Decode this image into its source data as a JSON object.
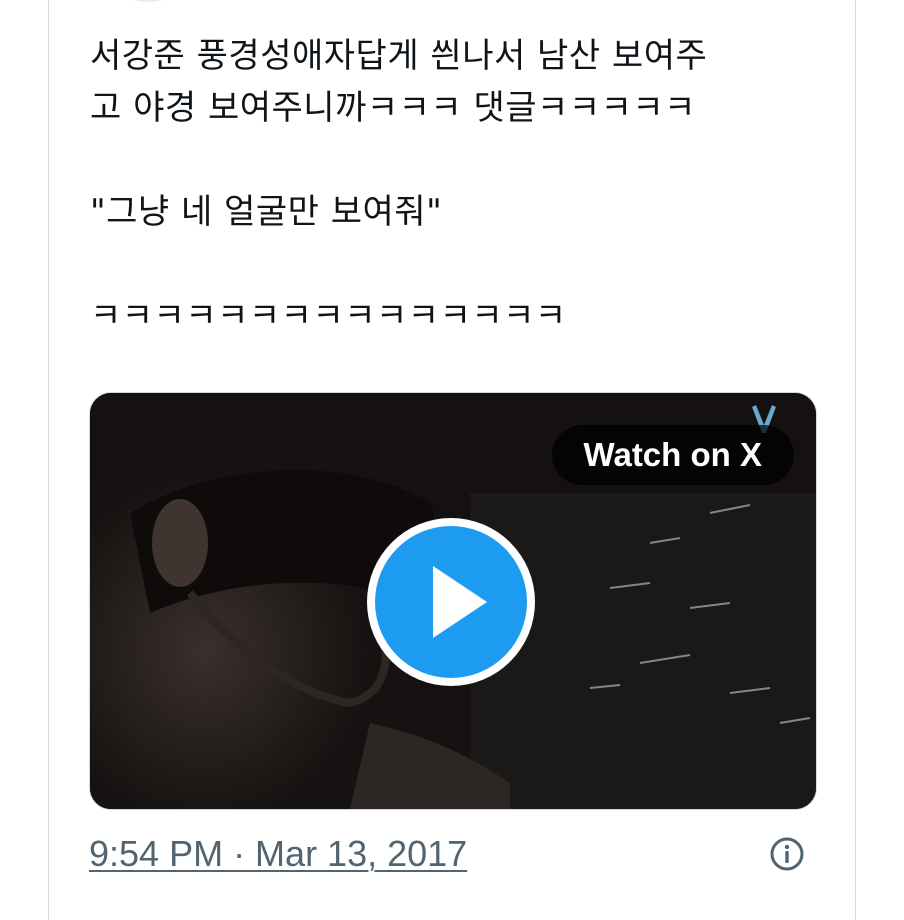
{
  "tweet": {
    "lines": [
      "서강준 풍경성애자답게 씐나서 남산 보여주",
      "고 야경 보여주니까ㅋㅋㅋ 댓글ㅋㅋㅋㅋㅋ",
      "\"그냥 네 얼굴만 보여줘\"",
      "ㅋㅋㅋㅋㅋㅋㅋㅋㅋㅋㅋㅋㅋㅋㅋ"
    ]
  },
  "media": {
    "watch_label": "Watch on X",
    "play_icon": "play-icon",
    "accent_color": "#1d9bf0"
  },
  "meta": {
    "timestamp": "9:54 PM · Mar 13, 2017",
    "info_icon": "info-icon"
  }
}
